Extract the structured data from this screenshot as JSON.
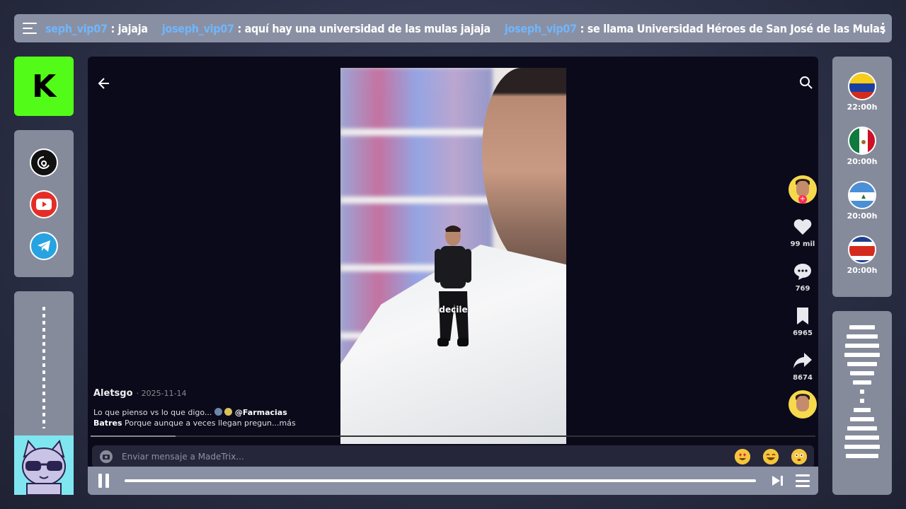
{
  "chat": {
    "messages": [
      {
        "user": "seph_vip07",
        "text": ": jajaja"
      },
      {
        "user": "joseph_vip07",
        "text": ": aquí hay una universidad de las mulas jajaja"
      },
      {
        "user": "joseph_vip07",
        "text": ": se llama Universidad Héroes de San José de las Mulas"
      }
    ]
  },
  "sidebar": {
    "logo_letter": "K",
    "logo_color": "#53fc18",
    "socials": [
      {
        "name": "threads",
        "icon": "threads-icon"
      },
      {
        "name": "youtube",
        "icon": "youtube-icon"
      },
      {
        "name": "telegram",
        "icon": "telegram-icon"
      }
    ]
  },
  "video": {
    "sticker_text": "decile",
    "author": "Aletsgo",
    "date": "· 2025-11-14",
    "description_start": "Lo que pienso vs lo que digo...",
    "mention": "@Farmacias",
    "mention_cont": "Batres",
    "description_end": "Porque aunque a veces llegan pregun...más",
    "likes": "99 mil",
    "comments": "769",
    "saves": "6965",
    "shares": "8674",
    "message_placeholder": "Enviar mensaje a MadeTrix...",
    "emojis": [
      "heart-eyes-emoji",
      "laughing-emoji",
      "flushed-emoji"
    ]
  },
  "schedule": [
    {
      "country": "Venezuela",
      "time": "22:00h"
    },
    {
      "country": "Mexico",
      "time": "20:00h"
    },
    {
      "country": "Nicaragua",
      "time": "20:00h"
    },
    {
      "country": "Costa Rica",
      "time": "20:00h"
    }
  ]
}
